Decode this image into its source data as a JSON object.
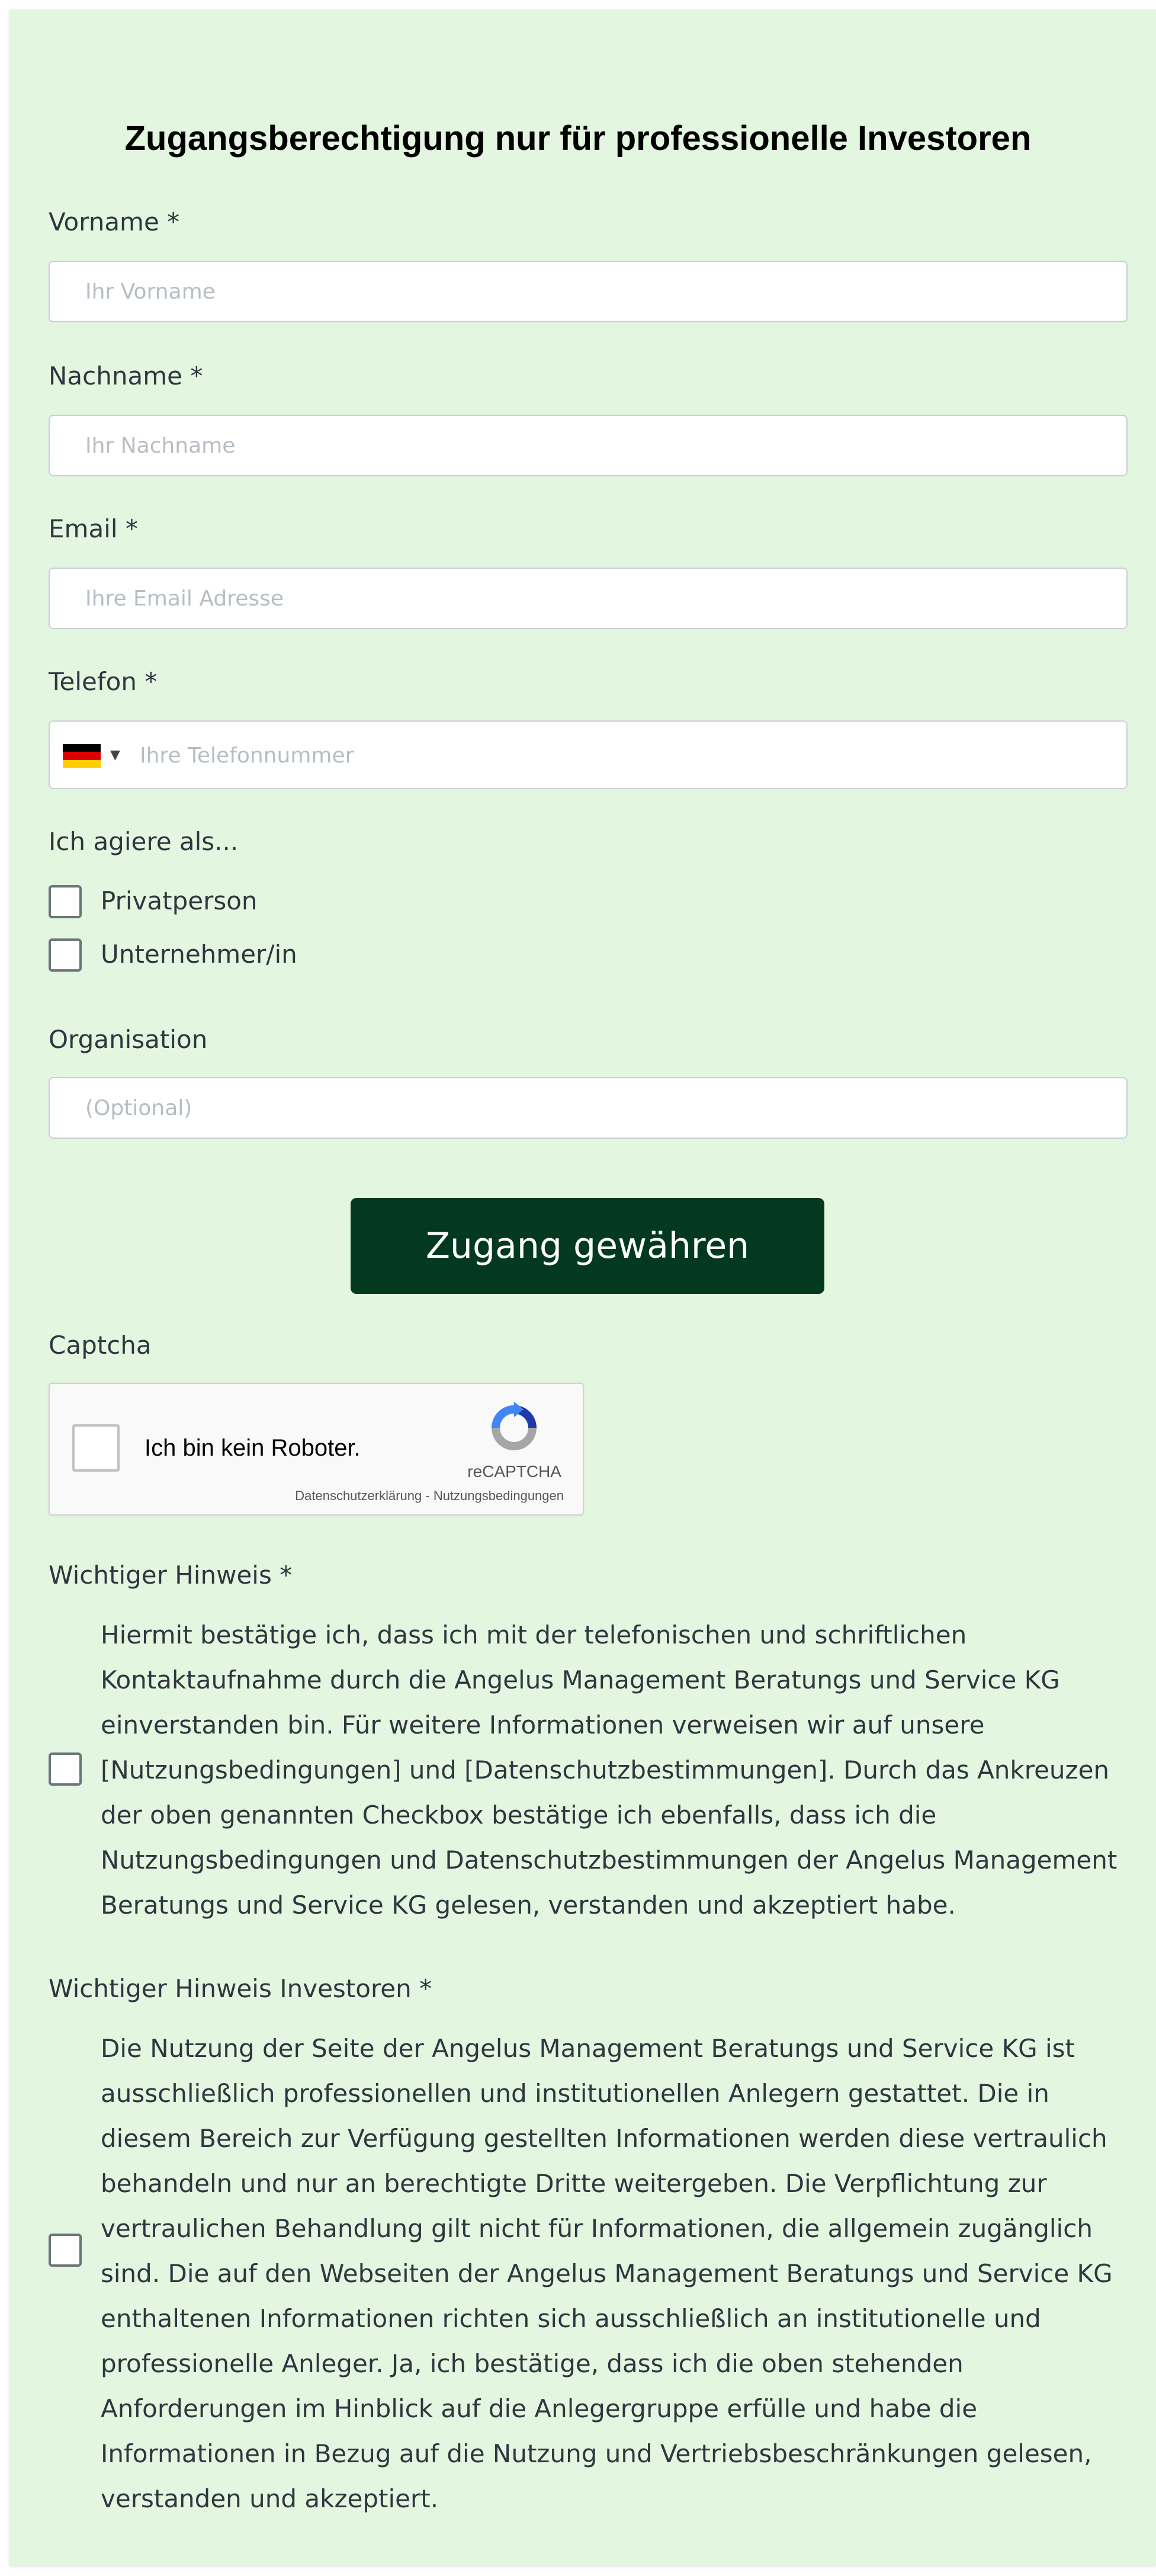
{
  "form": {
    "title": "Zugangsberechtigung nur für professionelle Investoren",
    "first_name": {
      "label": "Vorname *",
      "placeholder": "Ihr Vorname",
      "value": ""
    },
    "last_name": {
      "label": "Nachname *",
      "placeholder": "Ihr Nachname",
      "value": ""
    },
    "email": {
      "label": "Email *",
      "placeholder": "Ihre Email Adresse",
      "value": ""
    },
    "phone": {
      "label": "Telefon *",
      "placeholder": "Ihre Telefonnummer",
      "value": "",
      "country_flag": "germany-flag-icon"
    },
    "role": {
      "label": "Ich agiere als...",
      "options": [
        {
          "label": "Privatperson",
          "checked": false
        },
        {
          "label": "Unternehmer/in",
          "checked": false
        }
      ]
    },
    "organisation": {
      "label": "Organisation",
      "placeholder": "(Optional)",
      "value": ""
    },
    "submit_label": "Zugang gewähren",
    "captcha": {
      "label": "Captcha",
      "checkbox_text": "Ich bin kein Roboter.",
      "brand": "reCAPTCHA",
      "privacy_link": "Datenschutzerklärung",
      "separator": " - ",
      "terms_link": "Nutzungsbedingungen"
    },
    "notice": {
      "label": "Wichtiger Hinweis *",
      "text": "Hiermit bestätige ich, dass ich mit der telefonischen und schriftlichen Kontaktaufnahme durch die Angelus Management Beratungs und Service KG einverstanden bin. Für weitere Informationen verweisen wir auf unsere [Nutzungsbedingungen] und [Datenschutzbestimmungen]. Durch das Ankreuzen der oben genannten Checkbox bestätige ich ebenfalls, dass ich die Nutzungsbedingungen und Datenschutzbestimmungen der Angelus Management Beratungs und Service KG gelesen, verstanden und akzeptiert habe.",
      "checked": false
    },
    "investor_notice": {
      "label": "Wichtiger Hinweis Investoren *",
      "text": "Die Nutzung der Seite der Angelus Management Beratungs und Service KG ist ausschließlich professionellen und institutionellen Anlegern gestattet. Die in diesem Bereich zur Verfügung gestellten Informationen werden diese vertraulich behandeln und nur an berechtigte Dritte weitergeben. Die Verpflichtung zur vertraulichen Behandlung gilt nicht für Informationen, die allgemein zugänglich sind. Die auf den Webseiten der Angelus Management Beratungs und Service KG enthaltenen Informationen richten sich ausschließlich an institutionelle und professionelle Anleger. Ja, ich bestätige, dass ich die oben stehenden Anforderungen im Hinblick auf die Anlegergruppe erfülle und habe die Informationen in Bezug auf die Nutzung und Vertriebsbeschränkungen gelesen, verstanden und akzeptiert.",
      "checked": false
    }
  },
  "colors": {
    "background": "#e3f6df",
    "button": "#033a1f",
    "text": "#2f3640"
  }
}
